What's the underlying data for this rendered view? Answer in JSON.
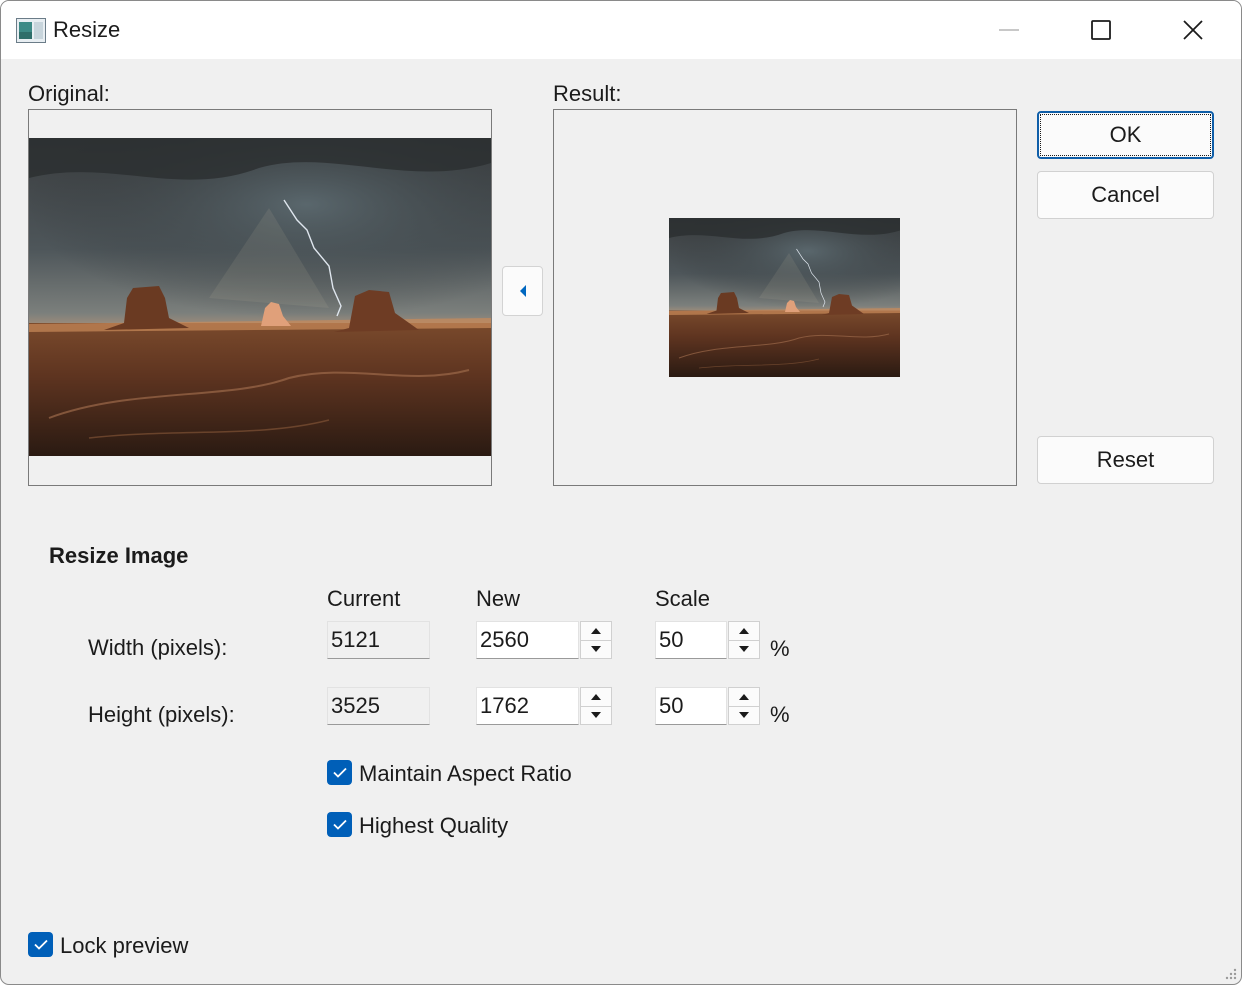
{
  "window": {
    "title": "Resize",
    "icon": "image-app-icon"
  },
  "titlebar": {
    "minimize_icon": "minimize-icon",
    "maximize_icon": "maximize-icon",
    "close_icon": "close-icon"
  },
  "preview": {
    "original_label": "Original:",
    "result_label": "Result:",
    "copy_icon": "chevron-left-icon"
  },
  "buttons": {
    "ok": "OK",
    "cancel": "Cancel",
    "reset": "Reset"
  },
  "resize": {
    "section_title": "Resize Image",
    "headers": {
      "current": "Current",
      "new": "New",
      "scale": "Scale"
    },
    "width": {
      "label": "Width (pixels):",
      "current": "5121",
      "new": "2560",
      "scale": "50",
      "unit": "%"
    },
    "height": {
      "label": "Height (pixels):",
      "current": "3525",
      "new": "1762",
      "scale": "50",
      "unit": "%"
    }
  },
  "options": {
    "maintain_aspect": {
      "label": "Maintain Aspect Ratio",
      "checked": true
    },
    "highest_quality": {
      "label": "Highest Quality",
      "checked": true
    },
    "lock_preview": {
      "label": "Lock preview",
      "checked": true
    }
  },
  "colors": {
    "accent": "#005fb8",
    "window_bg": "#f0f0f0",
    "titlebar_bg": "#ffffff"
  }
}
